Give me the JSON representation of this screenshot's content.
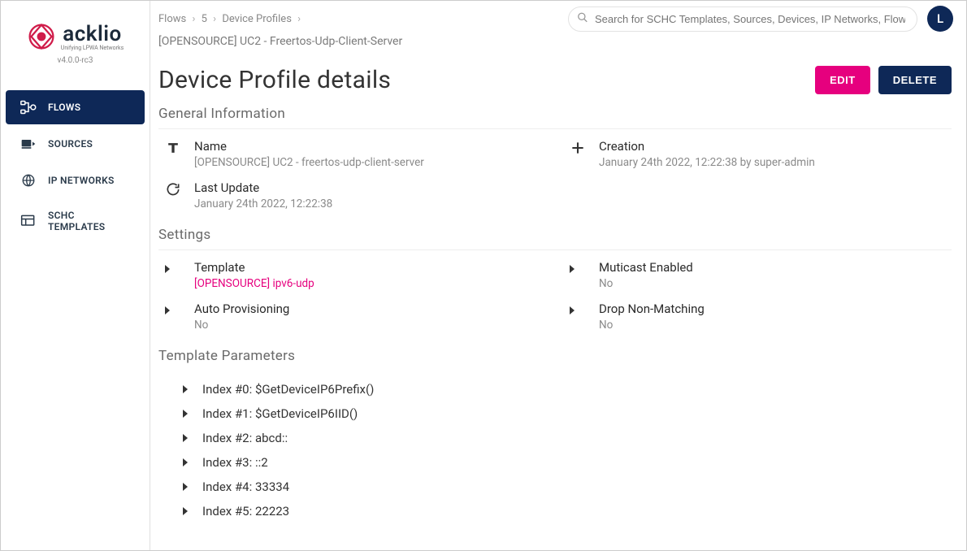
{
  "brand": {
    "name": "acklio",
    "tagline": "Unifying LPWA Networks",
    "version": "v4.0.0-rc3"
  },
  "sidebar": {
    "items": [
      {
        "label": "FLOWS"
      },
      {
        "label": "SOURCES"
      },
      {
        "label": "IP NETWORKS"
      },
      {
        "label": "SCHC TEMPLATES"
      }
    ]
  },
  "header": {
    "crumbs": [
      "Flows",
      "5",
      "Device Profiles"
    ],
    "subtitle": "[OPENSOURCE] UC2 - Freertos-Udp-Client-Server",
    "search_placeholder": "Search for SCHC Templates, Sources, Devices, IP Networks, Flows",
    "avatar_initial": "L"
  },
  "page": {
    "title": "Device Profile details",
    "buttons": {
      "edit": "EDIT",
      "delete": "DELETE"
    }
  },
  "sections": {
    "general": {
      "heading": "General Information",
      "name_label": "Name",
      "name_value": "[OPENSOURCE] UC2 - freertos-udp-client-server",
      "creation_label": "Creation",
      "creation_value": "January 24th 2022, 12:22:38 by super-admin",
      "lastupdate_label": "Last Update",
      "lastupdate_value": "January 24th 2022, 12:22:38"
    },
    "settings": {
      "heading": "Settings",
      "template_label": "Template",
      "template_value": "[OPENSOURCE] ipv6-udp",
      "multicast_label": "Muticast Enabled",
      "multicast_value": "No",
      "autoprov_label": "Auto Provisioning",
      "autoprov_value": "No",
      "dropnm_label": "Drop Non-Matching",
      "dropnm_value": "No"
    },
    "params": {
      "heading": "Template Parameters",
      "items": [
        "Index #0: $GetDeviceIP6Prefix()",
        "Index #1: $GetDeviceIP6IID()",
        "Index #2: abcd::",
        "Index #3: ::2",
        "Index #4: 33334",
        "Index #5: 22223"
      ]
    }
  }
}
